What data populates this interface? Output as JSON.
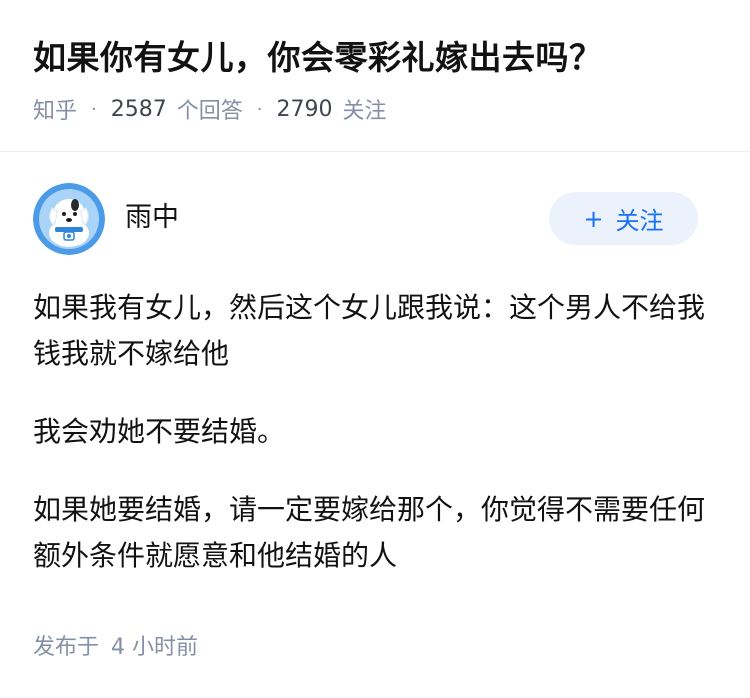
{
  "question": {
    "title": "如果你有女儿，你会零彩礼嫁出去吗？",
    "source": "知乎",
    "separator": "·",
    "answer_count": "2587",
    "answer_count_unit": "个回答",
    "follower_count": "2790",
    "follower_count_unit": "关注"
  },
  "author": {
    "name": "雨中",
    "avatar_icon": "cartoon-dog-avatar-icon",
    "follow_button": {
      "icon": "+",
      "label": "关注",
      "color": "#1772f6",
      "background": "#ebf2fb"
    }
  },
  "answer": {
    "paragraphs": [
      "如果我有女儿，然后这个女儿跟我说：这个男人不给我钱我就不嫁给他",
      "我会劝她不要结婚。",
      "如果她要结婚，请一定要嫁给那个，你觉得不需要任何额外条件就愿意和他结婚的人"
    ],
    "time_prefix": "发布于",
    "time_value": "4 小时前"
  },
  "colors": {
    "text_primary": "#121212",
    "text_meta": "#8590a6",
    "accent_blue": "#1772f6"
  }
}
